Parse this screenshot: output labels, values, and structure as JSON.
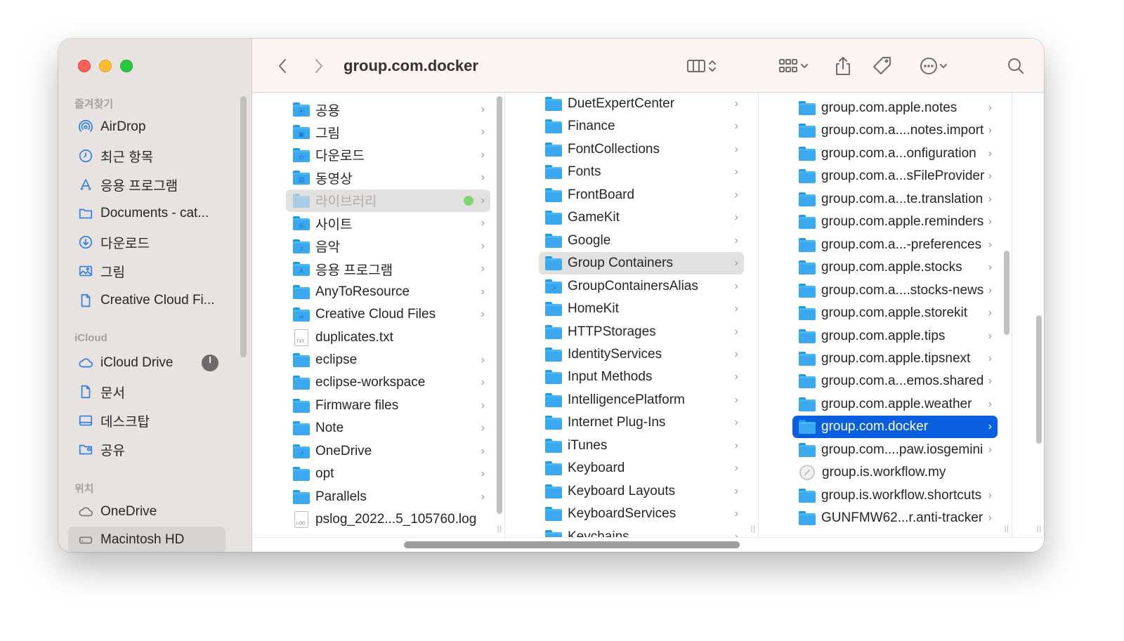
{
  "window": {
    "title": "group.com.docker"
  },
  "sidebar": {
    "sections": [
      {
        "title": "즐겨찾기",
        "items": [
          {
            "label": "AirDrop",
            "icon": "airdrop-icon"
          },
          {
            "label": "최근 항목",
            "icon": "clock-icon"
          },
          {
            "label": "응용 프로그램",
            "icon": "apps-icon"
          },
          {
            "label": "Documents - cat...",
            "icon": "folder-icon"
          },
          {
            "label": "다운로드",
            "icon": "download-icon"
          },
          {
            "label": "그림",
            "icon": "photo-icon"
          },
          {
            "label": "Creative Cloud Fi...",
            "icon": "document-icon"
          }
        ]
      },
      {
        "title": "iCloud",
        "items": [
          {
            "label": "iCloud Drive",
            "icon": "cloud-icon"
          },
          {
            "label": "문서",
            "icon": "document-icon"
          },
          {
            "label": "데스크탑",
            "icon": "desktop-icon"
          },
          {
            "label": "공유",
            "icon": "shared-folder-icon"
          }
        ]
      },
      {
        "title": "위치",
        "items": [
          {
            "label": "OneDrive",
            "icon": "cloud-icon"
          },
          {
            "label": "Macintosh HD",
            "icon": "disk-icon",
            "selected": true
          }
        ]
      }
    ]
  },
  "columns": [
    {
      "items": [
        {
          "label": "공용",
          "kind": "folder",
          "glyph": "⦿",
          "chevron": true
        },
        {
          "label": "그림",
          "kind": "folder",
          "glyph": "▣",
          "chevron": true
        },
        {
          "label": "다운로드",
          "kind": "folder",
          "glyph": "⊙",
          "chevron": true
        },
        {
          "label": "동영상",
          "kind": "folder",
          "glyph": "▤",
          "chevron": true
        },
        {
          "label": "라이브러리",
          "kind": "folder",
          "chevron": true,
          "state": "selected-dim",
          "tag": "green"
        },
        {
          "label": "사이트",
          "kind": "folder",
          "glyph": "◎",
          "chevron": true
        },
        {
          "label": "음악",
          "kind": "folder",
          "glyph": "♫",
          "chevron": true
        },
        {
          "label": "응용 프로그램",
          "kind": "folder",
          "glyph": "A",
          "chevron": true
        },
        {
          "label": "AnyToResource",
          "kind": "folder",
          "chevron": true
        },
        {
          "label": "Creative Cloud Files",
          "kind": "folder",
          "glyph": "∞",
          "chevron": true
        },
        {
          "label": "duplicates.txt",
          "kind": "file",
          "ext": "TXT",
          "chevron": false
        },
        {
          "label": "eclipse",
          "kind": "folder",
          "chevron": true
        },
        {
          "label": "eclipse-workspace",
          "kind": "folder",
          "chevron": true
        },
        {
          "label": "Firmware files",
          "kind": "folder",
          "chevron": true
        },
        {
          "label": "Note",
          "kind": "folder",
          "chevron": true
        },
        {
          "label": "OneDrive",
          "kind": "folder",
          "glyph": "↗",
          "chevron": true
        },
        {
          "label": "opt",
          "kind": "folder",
          "chevron": true
        },
        {
          "label": "Parallels",
          "kind": "folder",
          "chevron": true
        },
        {
          "label": "pslog_2022...5_105760.log",
          "kind": "file",
          "ext": "LOG",
          "chevron": false
        }
      ]
    },
    {
      "items": [
        {
          "label": "DuetExpertCenter",
          "kind": "folder",
          "chevron": true
        },
        {
          "label": "Finance",
          "kind": "folder",
          "chevron": true
        },
        {
          "label": "FontCollections",
          "kind": "folder",
          "chevron": true
        },
        {
          "label": "Fonts",
          "kind": "folder",
          "chevron": true
        },
        {
          "label": "FrontBoard",
          "kind": "folder",
          "chevron": true
        },
        {
          "label": "GameKit",
          "kind": "folder",
          "chevron": true
        },
        {
          "label": "Google",
          "kind": "folder",
          "chevron": true
        },
        {
          "label": "Group Containers",
          "kind": "folder",
          "chevron": true,
          "state": "selected-gray"
        },
        {
          "label": "GroupContainersAlias",
          "kind": "folder",
          "glyph": "↗",
          "chevron": true
        },
        {
          "label": "HomeKit",
          "kind": "folder",
          "chevron": true
        },
        {
          "label": "HTTPStorages",
          "kind": "folder",
          "chevron": true
        },
        {
          "label": "IdentityServices",
          "kind": "folder",
          "chevron": true
        },
        {
          "label": "Input Methods",
          "kind": "folder",
          "chevron": true
        },
        {
          "label": "IntelligencePlatform",
          "kind": "folder",
          "chevron": true
        },
        {
          "label": "Internet Plug-Ins",
          "kind": "folder",
          "chevron": true
        },
        {
          "label": "iTunes",
          "kind": "folder",
          "chevron": true
        },
        {
          "label": "Keyboard",
          "kind": "folder",
          "chevron": true
        },
        {
          "label": "Keyboard Layouts",
          "kind": "folder",
          "chevron": true
        },
        {
          "label": "KeyboardServices",
          "kind": "folder",
          "chevron": true
        },
        {
          "label": "Keychains",
          "kind": "folder",
          "chevron": true
        }
      ]
    },
    {
      "items": [
        {
          "label": "group.com.apple.notes",
          "kind": "folder",
          "chevron": true
        },
        {
          "label": "group.com.a....notes.import",
          "kind": "folder",
          "chevron": true
        },
        {
          "label": "group.com.a...onfiguration",
          "kind": "folder",
          "chevron": true
        },
        {
          "label": "group.com.a...sFileProvider",
          "kind": "folder",
          "chevron": true
        },
        {
          "label": "group.com.a...te.translation",
          "kind": "folder",
          "chevron": true
        },
        {
          "label": "group.com.apple.reminders",
          "kind": "folder",
          "chevron": true
        },
        {
          "label": "group.com.a...-preferences",
          "kind": "folder",
          "chevron": true
        },
        {
          "label": "group.com.apple.stocks",
          "kind": "folder",
          "chevron": true
        },
        {
          "label": "group.com.a....stocks-news",
          "kind": "folder",
          "chevron": true
        },
        {
          "label": "group.com.apple.storekit",
          "kind": "folder",
          "chevron": true
        },
        {
          "label": "group.com.apple.tips",
          "kind": "folder",
          "chevron": true
        },
        {
          "label": "group.com.apple.tipsnext",
          "kind": "folder",
          "chevron": true
        },
        {
          "label": "group.com.a...emos.shared",
          "kind": "folder",
          "chevron": true
        },
        {
          "label": "group.com.apple.weather",
          "kind": "folder",
          "chevron": true
        },
        {
          "label": "group.com.docker",
          "kind": "folder",
          "chevron": true,
          "state": "selected-blue"
        },
        {
          "label": "group.com....paw.iosgemini",
          "kind": "folder",
          "chevron": true
        },
        {
          "label": "group.is.workflow.my",
          "kind": "app",
          "chevron": false
        },
        {
          "label": "group.is.workflow.shortcuts",
          "kind": "folder",
          "chevron": true
        },
        {
          "label": "GUNFMW62...r.anti-tracker",
          "kind": "folder",
          "chevron": true
        }
      ]
    }
  ],
  "icons": {
    "back": "chevron-left-icon",
    "forward": "chevron-right-icon",
    "view": "column-view-icon",
    "group": "group-grid-icon",
    "share": "share-icon",
    "tag": "tag-icon",
    "more": "ellipsis-icon",
    "search": "search-icon"
  }
}
